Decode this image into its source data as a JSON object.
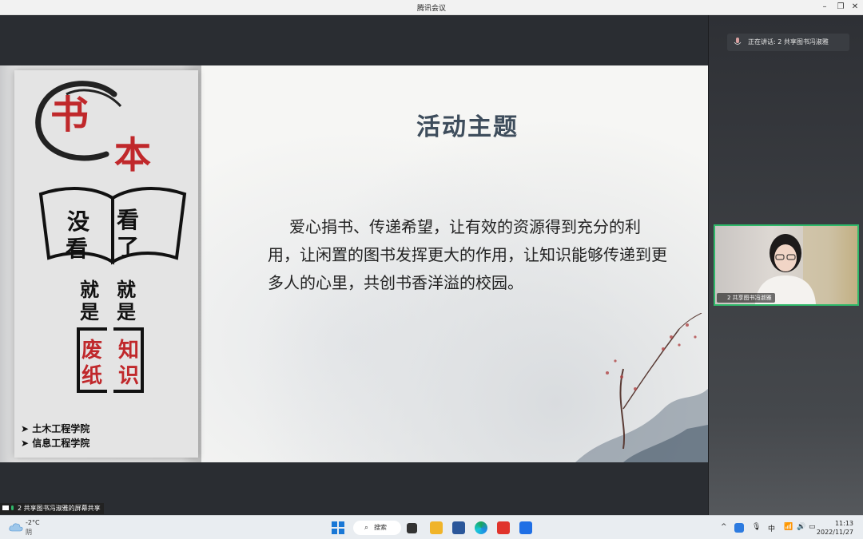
{
  "window": {
    "title": "腾讯会议"
  },
  "slide": {
    "title": "活动主题",
    "body": "爱心捐书、传递希望，让有效的资源得到充分的利用，让闲置的图书发挥更大的作用，让知识能够传递到更多人的心里，共创书香洋溢的校园。",
    "poster": {
      "brand_1": "书",
      "brand_2": "本",
      "left_col": [
        "没",
        "看",
        "就",
        "是",
        "废",
        "纸"
      ],
      "right_col": [
        "看",
        "了",
        "就",
        "是",
        "知",
        "识"
      ],
      "departments": [
        "➤ 土木工程学院",
        "➤ 信息工程学院"
      ]
    }
  },
  "speaking": {
    "label": "正在讲话: 2 共享图书冯淑雅"
  },
  "video": {
    "name": "2 共享图书冯淑雅"
  },
  "share_indicator": {
    "label": "2 共享图书冯淑雅的屏幕共享"
  },
  "taskbar": {
    "weather_temp": "-2°C",
    "weather_cond": "阴",
    "search_label": "搜索",
    "ime": "中",
    "time": "11:13",
    "date": "2022/11/27"
  }
}
